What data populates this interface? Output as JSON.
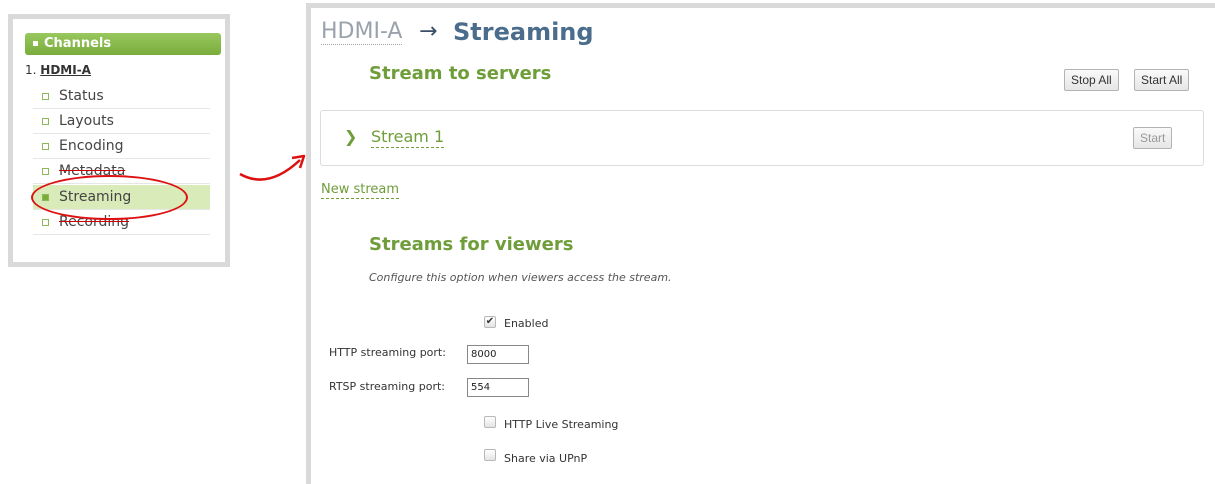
{
  "sidebar": {
    "header": "Channels",
    "channel_index": "1.",
    "channel_name": "HDMI-A",
    "items": [
      {
        "label": "Status",
        "active": false
      },
      {
        "label": "Layouts",
        "active": false
      },
      {
        "label": "Encoding",
        "active": false
      },
      {
        "label": "Metadata",
        "active": false
      },
      {
        "label": "Streaming",
        "active": true
      },
      {
        "label": "Recording",
        "active": false
      }
    ]
  },
  "annotation": {
    "color": "#d11111",
    "icons": [
      "highlight-circle",
      "curved-arrow-icon"
    ]
  },
  "breadcrumb": {
    "device": "HDMI-A",
    "separator": "→",
    "page": "Streaming"
  },
  "stream_to_servers": {
    "title": "Stream to servers",
    "stop_all_label": "Stop All",
    "start_all_label": "Start All",
    "streams": [
      {
        "name": "Stream 1",
        "start_label": "Start"
      }
    ],
    "new_stream_label": "New stream"
  },
  "viewers": {
    "title": "Streams for viewers",
    "description": "Configure this option when viewers access the stream.",
    "enabled_label": "Enabled",
    "enabled_checked": true,
    "http_port_label": "HTTP streaming port:",
    "http_port_value": "8000",
    "rtsp_port_label": "RTSP streaming port:",
    "rtsp_port_value": "554",
    "hls_label": "HTTP Live Streaming",
    "hls_checked": false,
    "upnp_label": "Share via UPnP",
    "upnp_checked": false
  },
  "colors": {
    "accent_green": "#6f9d3a",
    "title_blue": "#4a6d8c",
    "active_bg": "#d8ebb8"
  }
}
